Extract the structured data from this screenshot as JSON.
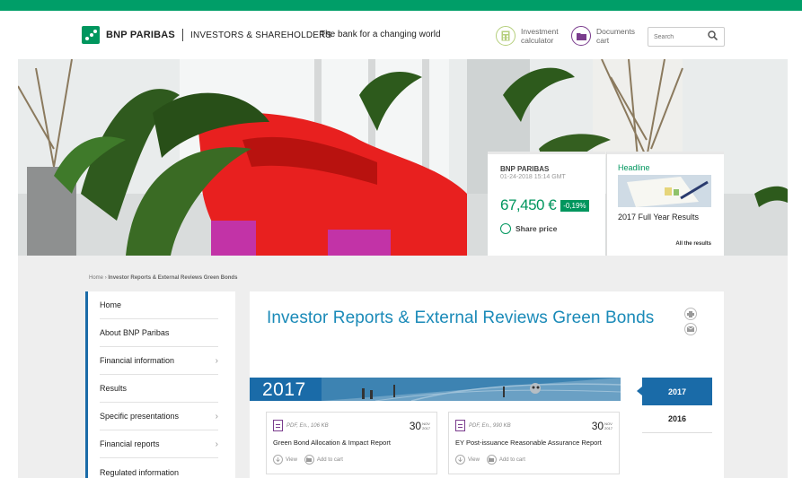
{
  "header": {
    "brand": "BNP PARIBAS",
    "section": "INVESTORS & SHAREHOLDERS",
    "tagline": "The bank for a changing world",
    "investment_calc": "Investment calculator",
    "documents_cart": "Documents cart",
    "search_placeholder": "Search"
  },
  "share": {
    "title": "BNP PARIBAS",
    "date": "01-24-2018 15:14 GMT",
    "price": "67,450 €",
    "change": "-0,19%",
    "link": "Share price"
  },
  "headline": {
    "title": "Headline",
    "text": "2017 Full Year Results",
    "all": "All the results"
  },
  "breadcrumb": {
    "home": "Home",
    "current": "Investor Reports & External Reviews Green Bonds"
  },
  "sidebar": {
    "items": [
      {
        "label": "Home"
      },
      {
        "label": "About BNP Paribas"
      },
      {
        "label": "Financial information"
      },
      {
        "label": "Results"
      },
      {
        "label": "Specific presentations"
      },
      {
        "label": "Financial reports"
      },
      {
        "label": "Regulated information"
      }
    ]
  },
  "main": {
    "title": "Investor Reports & External Reviews Green Bonds",
    "year_banner": "2017",
    "years": [
      "2017",
      "2016"
    ]
  },
  "documents": [
    {
      "meta": "PDF, En., 106 KB",
      "day": "30",
      "month": "NOV",
      "year": "2017",
      "title": "Green Bond Allocation & Impact Report",
      "view": "View",
      "cart": "Add to cart"
    },
    {
      "meta": "PDF, En., 990 KB",
      "day": "30",
      "month": "NOV",
      "year": "2017",
      "title": "EY Post-issuance Reasonable Assurance Report",
      "view": "View",
      "cart": "Add to cart"
    }
  ],
  "colors": {
    "brand_green": "#00965e",
    "blue": "#1a6ba8",
    "title_blue": "#1a8ab8",
    "purple": "#7a3c8d"
  }
}
